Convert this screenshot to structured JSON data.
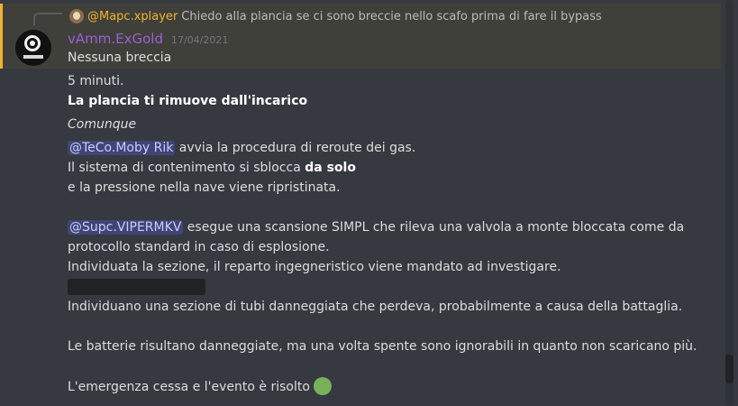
{
  "reply": {
    "author": "@Mapc.xplayer",
    "text": "Chiedo alla plancia se ci sono breccie nello scafo prima di fare il bypass"
  },
  "message": {
    "username": "vAmm.ExGold",
    "timestamp": "17/04/2021",
    "lines": {
      "l1": "Nessuna breccia",
      "l2": "5 minuti.",
      "l3": "La plancia ti rimuove dall'incarico",
      "l4": "Comunque",
      "l5_mention": "@TeCo.Moby Rik",
      "l5_text": " avvia la procedura di reroute dei gas.",
      "l6_text": "Il sistema di contenimento si sblocca ",
      "l6_bold": "da solo",
      "l7": "e la pressione nella nave viene ripristinata.",
      "l8_mention": "@Supc.VIPERMKV",
      "l8_text": " esegue una scansione SIMPL che rileva una valvola a monte bloccata come da",
      "l9": "protocollo standard in caso di esplosione.",
      "l10": "Individuata la sezione, il reparto ingegneristico viene mandato ad investigare.",
      "l11": "Individuano una sezione di tubi danneggiata che perdeva, probabilmente a causa della battaglia.",
      "l12": "Le batterie risultano danneggiate, ma una volta spente sono ignorabili in quanto non scaricano più.",
      "l13": "L'emergenza cessa e l'evento è risolto"
    }
  },
  "icons": {
    "reply_avatar": "reply-avatar-icon",
    "emoji": "green-circle-emoji-icon"
  },
  "colors": {
    "background": "#36393f",
    "highlight": "#40403a",
    "highlight_border": "#f0b232",
    "username": "#9a5fd6",
    "mention_bg": "#5865f2",
    "emoji": "#78b159"
  }
}
